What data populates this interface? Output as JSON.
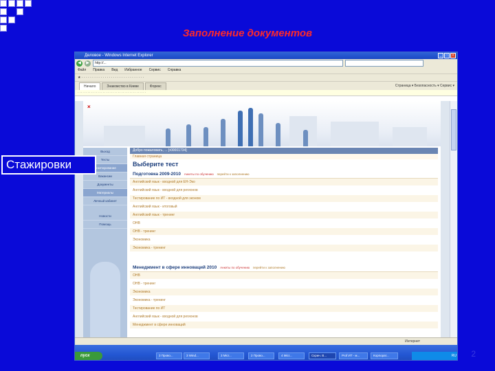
{
  "slide": {
    "title": "Заполнение документов",
    "label": "Стажировки",
    "page_number": "2"
  },
  "browser": {
    "window_title": "Деловое - Windows Internet Explorer",
    "address": "http://...",
    "menu": [
      "Файл",
      "Правка",
      "Вид",
      "Избранное",
      "Сервис",
      "Справка"
    ],
    "tabs": [
      "Начало",
      "Знакомство в Киеве",
      "Форекс"
    ],
    "toolbar_right": "Страница ▾  Безопасность ▾  Сервис ▾",
    "status": "Интернет"
  },
  "site": {
    "nav": [
      "Выход",
      "Тесты",
      "Анкетирование",
      "Вакансии",
      "Документы",
      "Материалы",
      "Личный кабинет",
      "Новости",
      "Помощь"
    ],
    "welcome": "Добро пожаловать, ... [•00001734]",
    "breadcrumb": "Главная страница",
    "choose_title": "Выберите тест",
    "section1": {
      "title": "Подготовка 2009-2010",
      "link": "Анкеты по обучению",
      "reg": "перейти к заполнению",
      "items": [
        "Английский язык - входной для ЕН-Эко",
        "Английский язык - входной для регионов",
        "Тестирование по ИТ - входной для эконом",
        "Английский язык - итоговый",
        "Английский язык - тренинг",
        "ОНВ",
        "ОНВ - тренинг",
        "Экономика",
        "Экономика - тренинг"
      ]
    },
    "section2": {
      "title": "Менеджмент в сфере инноваций 2010",
      "link": "Анкеты по обучению",
      "reg": "перейти к заполнению",
      "items": [
        "ОНВ",
        "ОНВ - тренинг",
        "Экономика",
        "Экономика - тренинг",
        "Тестирование по ИТ",
        "Английский язык - входной для регионов",
        "Менеджмент в сфере инноваций"
      ]
    }
  },
  "taskbar": {
    "start": "пуск",
    "items": [
      "3 Прово...",
      "3 Wind...",
      "3 Micr...",
      "2 Прово...",
      "4 Micr...",
      "Скрин. В...",
      "Prof ИT - м...",
      "Корпорат..."
    ],
    "tray": "RU"
  }
}
